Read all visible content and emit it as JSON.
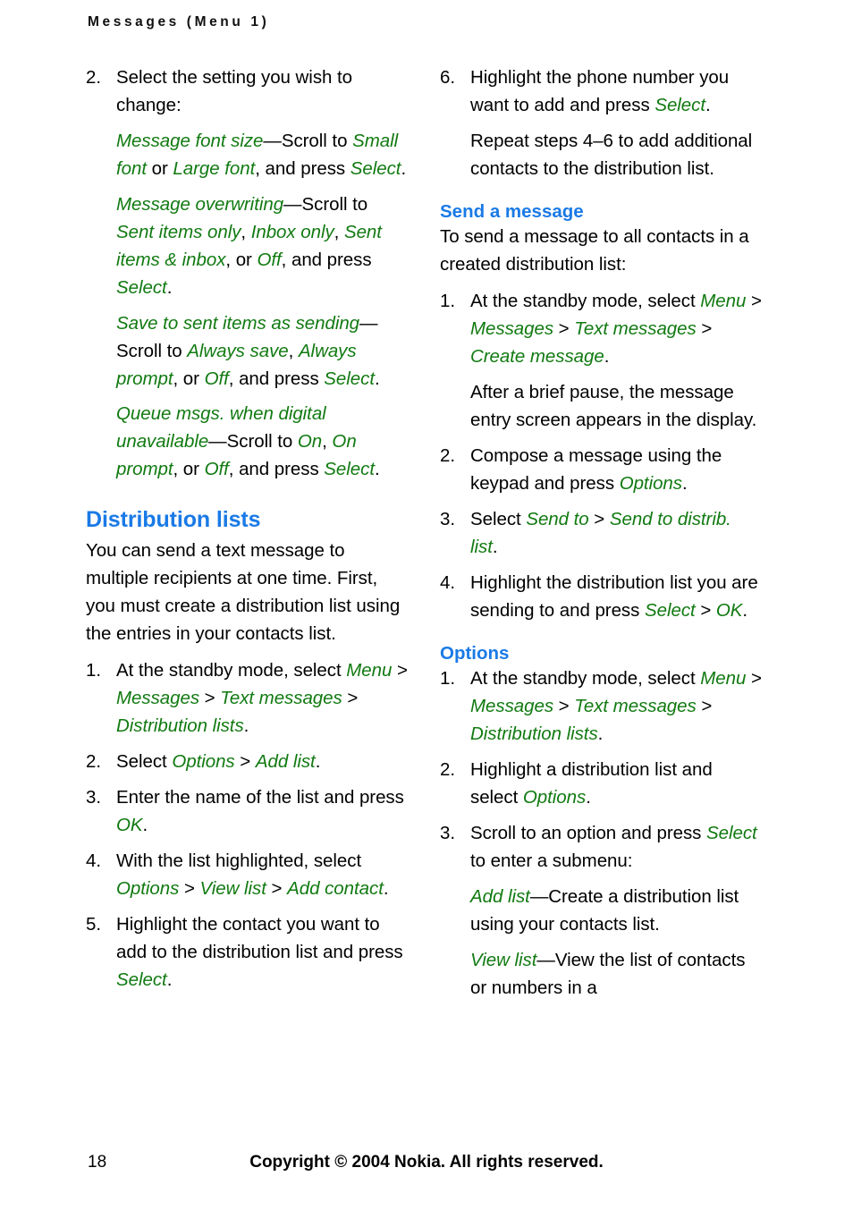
{
  "header": {
    "running_title": "Messages (Menu 1)"
  },
  "footer": {
    "page_number": "18",
    "copyright": "Copyright © 2004 Nokia. All rights reserved."
  },
  "left_column": {
    "step2": {
      "num": "2.",
      "text": "Select the setting you wish to change:"
    },
    "setting_font_size": {
      "term": "Message font size",
      "t1": "—Scroll to ",
      "opt1": "Small font",
      "t2": " or ",
      "opt2": "Large font",
      "t3": ", and press ",
      "opt3": "Select",
      "t4": "."
    },
    "setting_overwriting": {
      "term": "Message overwriting",
      "t1": "—Scroll to ",
      "opt1": "Sent items only",
      "t2": ", ",
      "opt2": "Inbox only",
      "t3": ", ",
      "opt3": "Sent items & inbox",
      "t4": ", or ",
      "opt4": "Off",
      "t5": ", and press ",
      "opt5": "Select",
      "t6": "."
    },
    "setting_save_sent": {
      "term": "Save to sent items as sending",
      "t1": "—Scroll to ",
      "opt1": "Always save",
      "t2": ", ",
      "opt2": "Always prompt",
      "t3": ", or ",
      "opt3": "Off",
      "t4": ", and press ",
      "opt4": "Select",
      "t5": "."
    },
    "setting_queue": {
      "term": "Queue msgs. when digital unavailable",
      "t1": "—Scroll to ",
      "opt1": "On",
      "t2": ", ",
      "opt2": "On prompt",
      "t3": ", or ",
      "opt3": "Off",
      "t4": ", and press ",
      "opt4": "Select",
      "t5": "."
    },
    "heading": "Distribution lists",
    "intro": "You can send a text message to multiple recipients at one time. First, you must create a distribution list using the entries in your contacts list.",
    "step1": {
      "num": "1.",
      "t1": "At the standby mode, select ",
      "p1": "Menu",
      "s1": " > ",
      "p2": "Messages",
      "s2": " > ",
      "p3": "Text messages",
      "s3": " > ",
      "p4": "Distribution lists",
      "t2": "."
    },
    "step2b": {
      "num": "2.",
      "t1": "Select ",
      "p1": "Options",
      "s1": " > ",
      "p2": "Add list",
      "t2": "."
    },
    "step3": {
      "num": "3.",
      "t1": "Enter the name of the list and press ",
      "p1": "OK",
      "t2": "."
    },
    "step4": {
      "num": "4.",
      "t1": "With the list highlighted, select ",
      "p1": "Options",
      "s1": " > ",
      "p2": "View list",
      "s2": " > ",
      "p3": "Add contact",
      "t2": "."
    },
    "step5": {
      "num": "5.",
      "t1": "Highlight the contact you want to add to the distribution list and press ",
      "p1": "Select",
      "t2": "."
    }
  },
  "right_column": {
    "step6": {
      "num": "6.",
      "t1": "Highlight the phone number you want to add and press ",
      "p1": "Select",
      "t2": "."
    },
    "step6_note": "Repeat steps 4–6 to add additional contacts to the distribution list.",
    "send_heading": "Send a message",
    "send_intro": "To send a message to all contacts in a created distribution list:",
    "send_step1": {
      "num": "1.",
      "t1": "At the standby mode, select ",
      "p1": "Menu",
      "s1": " > ",
      "p2": "Messages",
      "s2": " > ",
      "p3": "Text messages",
      "s3": " > ",
      "p4": "Create message",
      "t2": "."
    },
    "send_step1_note": "After a brief pause, the message entry screen appears in the display.",
    "send_step2": {
      "num": "2.",
      "t1": "Compose a message using the keypad and press ",
      "p1": "Options",
      "t2": "."
    },
    "send_step3": {
      "num": "3.",
      "t1": "Select ",
      "p1": "Send to",
      "s1": " > ",
      "p2": "Send to distrib. list",
      "t2": "."
    },
    "send_step4": {
      "num": "4.",
      "t1": "Highlight the distribution list you are sending to and press ",
      "p1": "Select",
      "s1": " > ",
      "p2": "OK",
      "t2": "."
    },
    "options_heading": "Options",
    "opt_step1": {
      "num": "1.",
      "t1": "At the standby mode, select ",
      "p1": "Menu",
      "s1": " > ",
      "p2": "Messages",
      "s2": " > ",
      "p3": "Text messages",
      "s3": " > ",
      "p4": "Distribution lists",
      "t2": "."
    },
    "opt_step2": {
      "num": "2.",
      "t1": "Highlight a distribution list and select ",
      "p1": "Options",
      "t2": "."
    },
    "opt_step3": {
      "num": "3.",
      "t1": "Scroll to an option and press ",
      "p1": "Select",
      "t2": " to enter a submenu:"
    },
    "opt_add_list": {
      "term": "Add list",
      "t1": "—Create a distribution list using your contacts list."
    },
    "opt_view_list": {
      "term": "View list",
      "t1": "—View the list of contacts or numbers in a"
    }
  },
  "colors": {
    "heading_blue": "#1a7ae6",
    "ui_green": "#117a11",
    "body_black": "#000000"
  }
}
